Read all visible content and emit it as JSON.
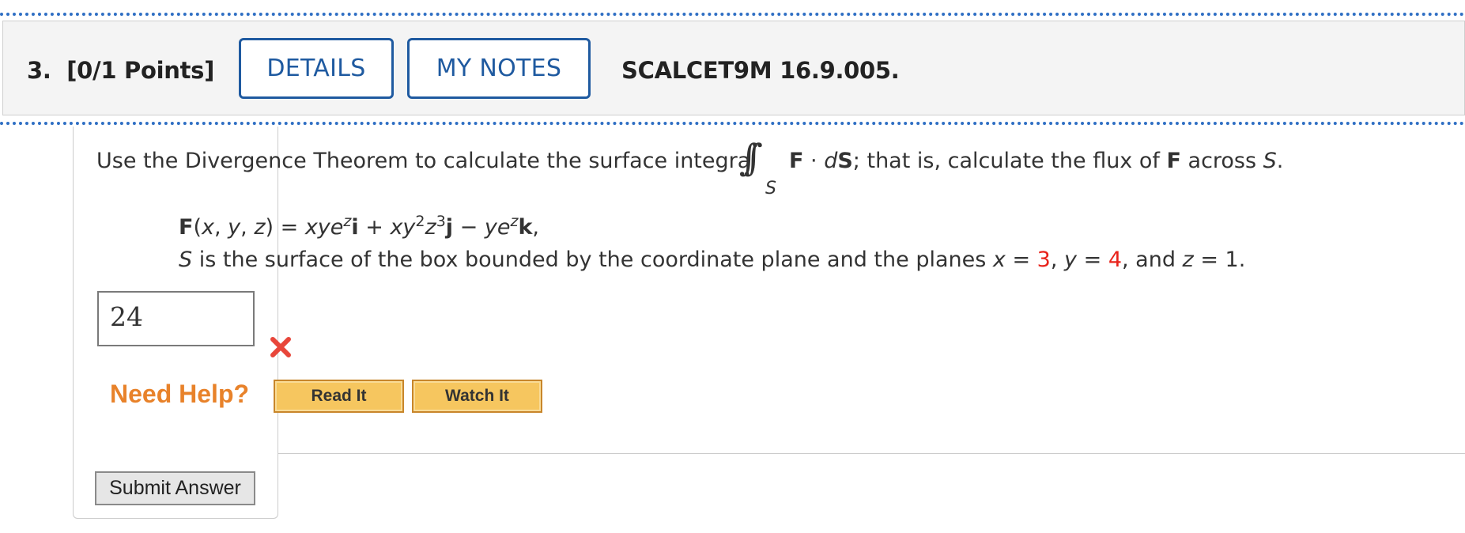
{
  "header": {
    "question_number": "3.",
    "points": "[0/1 Points]",
    "details_label": "DETAILS",
    "my_notes_label": "MY NOTES",
    "assignment_code": "SCALCET9M 16.9.005."
  },
  "question": {
    "intro": "Use the Divergence Theorem to calculate the surface integral",
    "integral_symbol": "∫∫",
    "integral_subscript": "S",
    "after_integral_F": "F",
    "after_integral_dot": " · ",
    "after_integral_dS_d": "d",
    "after_integral_dS_S": "S",
    "after_integral_rest_1": "; that is, calculate the flux of ",
    "after_integral_F2": "F",
    "after_integral_rest_2": " across ",
    "after_integral_S": "S",
    "after_integral_end": ".",
    "field_label": "F",
    "surface_S": "S",
    "surface_text": " is the surface of the box bounded by the coordinate plane and the planes ",
    "x_val": "3",
    "y_val": "4",
    "z_val": "1"
  },
  "answer": {
    "value": "24",
    "status": "incorrect"
  },
  "help": {
    "need_help_label": "Need Help?",
    "read_it_label": "Read It",
    "watch_it_label": "Watch It"
  },
  "submit": {
    "label": "Submit Answer"
  },
  "colors": {
    "accent_blue": "#1f5aa0",
    "error_red": "#e8231b",
    "help_orange": "#e8822a",
    "help_button": "#f6c65f"
  }
}
